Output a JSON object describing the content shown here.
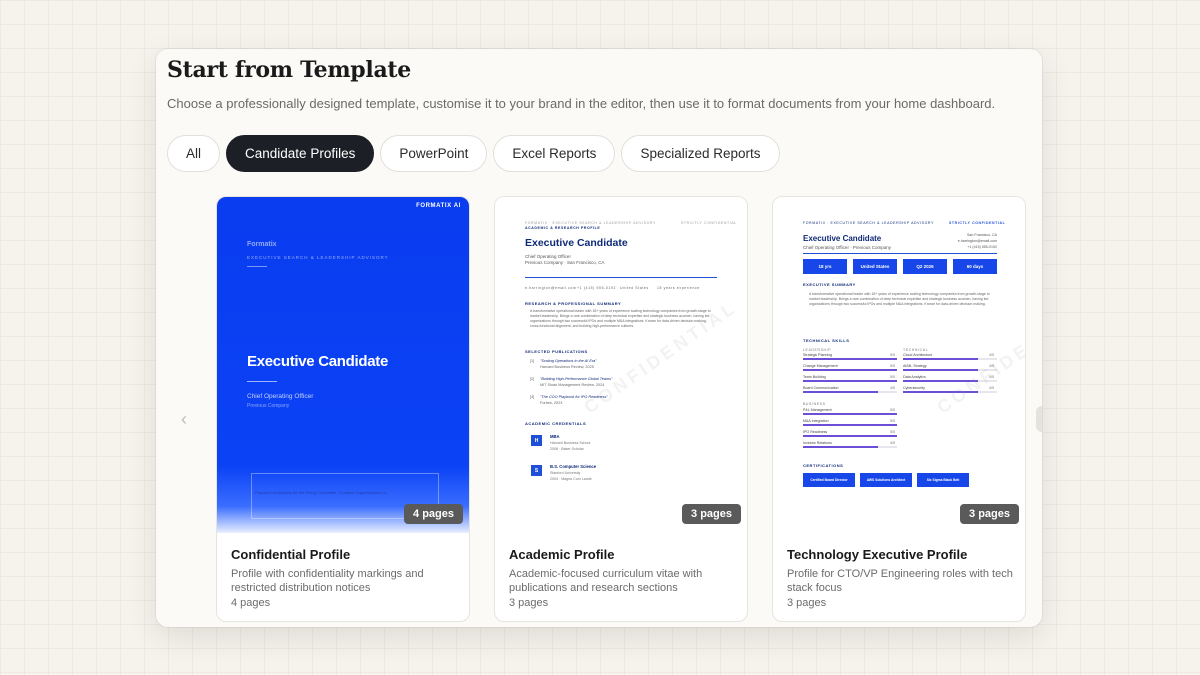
{
  "modal": {
    "title": "Start from Template",
    "subtitle": "Choose a professionally designed template, customise it to your brand in the editor, then use it to format documents from your home dashboard."
  },
  "tabs": [
    {
      "label": "All",
      "active": false
    },
    {
      "label": "Candidate Profiles",
      "active": true
    },
    {
      "label": "PowerPoint",
      "active": false
    },
    {
      "label": "Excel Reports",
      "active": false
    },
    {
      "label": "Specialized Reports",
      "active": false
    }
  ],
  "carousel": {
    "prev_icon": "chevron-left-icon",
    "prev_glyph": "‹"
  },
  "cards": [
    {
      "title": "Confidential Profile",
      "description": "Profile with confidentiality markings and restricted distribution notices",
      "pages_label": "4 pages",
      "badge": "4 pages",
      "preview": {
        "logo": "FORMATIX AI",
        "brand": "Formatix",
        "brand_sub": "EXECUTIVE SEARCH & LEADERSHIP ADVISORY",
        "name": "Executive Candidate",
        "role": "Chief Operating Officer",
        "previous": "Previous Company",
        "footer": "Prepared exclusively for the Hiring Committee. Contains Organisations Inc."
      }
    },
    {
      "title": "Academic Profile",
      "description": "Academic-focused curriculum vitae with publications and research sections",
      "pages_label": "3 pages",
      "badge": "3 pages",
      "preview": {
        "header": "FORMATIX · EXECUTIVE SEARCH & LEADERSHIP ADVISORY",
        "kind": "ACADEMIC & RESEARCH PROFILE",
        "conf": "STRICTLY CONFIDENTIAL",
        "name": "Executive Candidate",
        "role": "Chief Operating Officer",
        "previous": "Previous Company · San Francisco, CA",
        "contact": "e.harrington@email.com",
        "phone": "+1 (415) 555-0192",
        "country": "United States",
        "years": "18 years experience",
        "sec_research": "RESEARCH & PROFESSIONAL SUMMARY",
        "summary": "A transformative operational leader with 18+ years of experience scaling technology companies from growth-stage to market leadership. Brings a rare combination of deep technical expertise and strategic business acumen, having led organizations through two successful IPOs and multiple M&A integrations. Known for data-driven decision making, cross-functional alignment, and building high-performance cultures.",
        "sec_pubs": "SELECTED PUBLICATIONS",
        "pubs": [
          {
            "num": "[1]",
            "title": "\"Scaling Operations in the AI Era\"",
            "venue": "Harvard Business Review, 2025"
          },
          {
            "num": "[2]",
            "title": "\"Building High-Performance Global Teams\"",
            "venue": "MIT Sloan Management Review, 2024"
          },
          {
            "num": "[3]",
            "title": "\"The COO Playbook for IPO Readiness\"",
            "venue": "Forbes, 2023"
          }
        ],
        "sec_creds": "ACADEMIC CREDENTIALS",
        "creds": [
          {
            "icon": "H",
            "title": "MBA",
            "school": "Harvard Business School",
            "detail": "2008 · Baker Scholar"
          },
          {
            "icon": "S",
            "title": "B.S. Computer Science",
            "school": "Stanford University",
            "detail": "2004 · Magna Cum Laude"
          }
        ],
        "watermark": "CONFIDENTIAL"
      }
    },
    {
      "title": "Technology Executive Profile",
      "description": "Profile for CTO/VP Engineering roles with tech stack focus",
      "pages_label": "3 pages",
      "badge": "3 pages",
      "preview": {
        "header": "FORMATIX · EXECUTIVE SEARCH & LEADERSHIP ADVISORY",
        "conf": "STRICTLY CONFIDENTIAL",
        "name": "Executive Candidate",
        "role": "Chief Operating Officer · Previous Company",
        "location": "San Francisco, CA",
        "email": "e.harrington@email.com",
        "phone": "+1 (415) 555-0192",
        "stats": [
          "18 yrs",
          "United States",
          "Q2 2026",
          "60 days"
        ],
        "sec_summary": "EXECUTIVE SUMMARY",
        "summary": "A transformative operational leader with 18+ years of experience scaling technology companies from growth-stage to market leadership. Brings a rare combination of deep technical expertise and strategic business acumen, having led organizations through two successful IPOs and multiple M&A integrations. Known for data-driven decision making.",
        "sec_skills": "TECHNICAL SKILLS",
        "group_leadership": "LEADERSHIP",
        "group_technical": "TECHNICAL",
        "group_business": "BUSINESS",
        "skills_left": [
          {
            "name": "Strategic Planning",
            "score": "5/5",
            "level": 1.0
          },
          {
            "name": "Change Management",
            "score": "5/5",
            "level": 1.0
          },
          {
            "name": "Team Building",
            "score": "5/5",
            "level": 1.0
          },
          {
            "name": "Board Communication",
            "score": "4/5",
            "level": 0.8
          }
        ],
        "skills_right": [
          {
            "name": "Cloud Architecture",
            "score": "4/5",
            "level": 0.8
          },
          {
            "name": "AI/ML Strategy",
            "score": "4/5",
            "level": 0.8
          },
          {
            "name": "Data Analytics",
            "score": "4/5",
            "level": 0.8
          },
          {
            "name": "Cybersecurity",
            "score": "4/5",
            "level": 0.8
          }
        ],
        "skills_business": [
          {
            "name": "P&L Management",
            "score": "5/5",
            "level": 1.0
          },
          {
            "name": "M&A Integration",
            "score": "5/5",
            "level": 1.0
          },
          {
            "name": "IPO Readiness",
            "score": "5/5",
            "level": 1.0
          },
          {
            "name": "Investor Relations",
            "score": "4/5",
            "level": 0.8
          }
        ],
        "sec_certs": "CERTIFICATIONS",
        "certs": [
          "Certified Board Director",
          "AWS Solutions Architect",
          "Six Sigma Black Belt"
        ],
        "watermark": "CONFIDENTIAL"
      }
    }
  ]
}
